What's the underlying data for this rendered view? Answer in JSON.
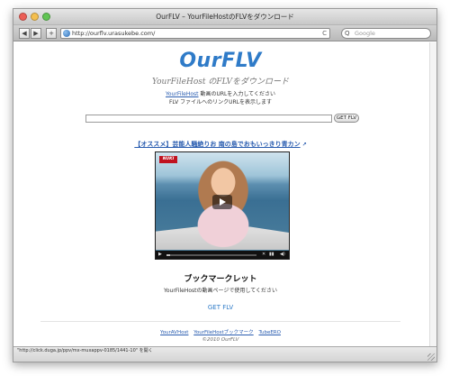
{
  "window": {
    "title": "OurFLV – YourFileHostのFLVをダウンロード"
  },
  "toolbar": {
    "back_glyph": "◀",
    "forward_glyph": "▶",
    "add_glyph": "+",
    "url": "http://ourflv.urasukebe.com/",
    "reload_glyph": "C",
    "search_placeholder": "Google",
    "search_glyph": "Q"
  },
  "page": {
    "logo": "OurFLV",
    "subtitle": "YourFileHost のFLVをダウンロード",
    "desc_link": "YourFileHost",
    "desc1_rest": " 動画のURLを入力してください",
    "desc2": "FLV ファイルへのリンクURLを表示します",
    "get_button": "GET FLV",
    "promo": "【オススメ】芸能人騒絶りお 南の島でおもいっきり青カン",
    "promo_ext": "↗",
    "video": {
      "badge": "NUKI",
      "progress": 0.04
    },
    "bookmarklet_title": "ブックマークレット",
    "bookmarklet_desc": "YourFileHostの動画ページで使用してください",
    "bookmarklet_link": "GET FLV",
    "footer_links": [
      "YourAVHost",
      "YourFileHostブックマーク",
      "TubeERO"
    ],
    "copyright": "©2010 OurFLV"
  },
  "status": {
    "text": "\"http://click.duga.jp/ppv/mx-muxappv-0185/1441-10\" を開く"
  },
  "colors": {
    "logo": "#2f7bc8",
    "link": "#2a5db0"
  }
}
